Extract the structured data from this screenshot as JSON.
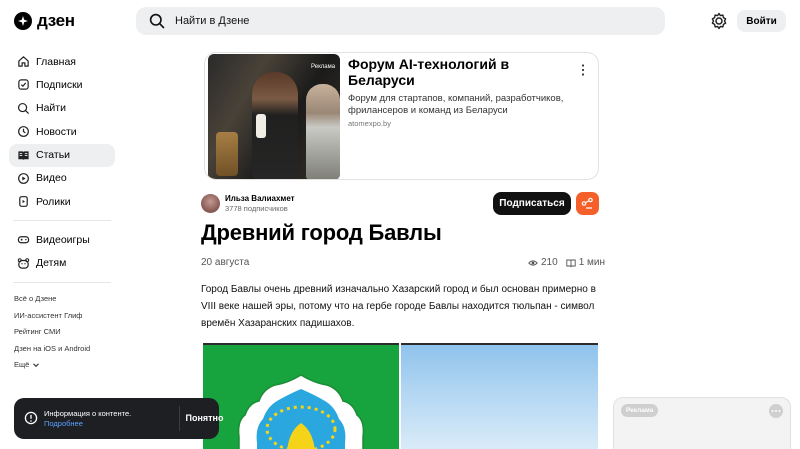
{
  "header": {
    "logo_text": "дзен",
    "search_placeholder": "Найти в Дзене",
    "login_label": "Войти"
  },
  "sidebar": {
    "items": [
      {
        "label": "Главная",
        "icon": "home-icon"
      },
      {
        "label": "Подписки",
        "icon": "subscriptions-icon"
      },
      {
        "label": "Найти",
        "icon": "search-icon"
      },
      {
        "label": "Новости",
        "icon": "news-icon"
      },
      {
        "label": "Статьи",
        "icon": "articles-icon",
        "active": true
      },
      {
        "label": "Видео",
        "icon": "video-icon"
      },
      {
        "label": "Ролики",
        "icon": "shorts-icon"
      }
    ],
    "extra_items": [
      {
        "label": "Видеоигры",
        "icon": "gamepad-icon"
      },
      {
        "label": "Детям",
        "icon": "kids-icon"
      }
    ],
    "footer_links": [
      "Всё о Дзене",
      "ИИ-ассистент Глиф",
      "Рейтинг СМИ",
      "Дзен на iOS и Android",
      "Ещё"
    ]
  },
  "ad": {
    "image_tag": "Реклама",
    "title": "Форум AI-технологий в Беларуси",
    "description": "Форум для стартапов, компаний, разработчиков, фрилансеров и команд из Беларуси",
    "domain": "atomexpo.by"
  },
  "author": {
    "name": "Ильза Валиахмет",
    "subscribers": "3778 подписчиков",
    "subscribe_label": "Подписаться"
  },
  "article": {
    "title": "Древний город Бавлы",
    "date": "20 августа",
    "views": "210",
    "read_time": "1 мин",
    "body": "Город Бавлы очень древний изначально Хазарский город и был основан примерно в VIII веке нашей эры, потому что на гербе городе Бавлы находится тюльпан - символ времён Хазаранских падишахов."
  },
  "toast": {
    "text": "Информация о контенте.",
    "link": "Подробнее",
    "button": "Понятно"
  },
  "mini_ad": {
    "tag": "Реклама"
  },
  "colors": {
    "accent_orange": "#f55f2a",
    "button_dark": "#111111",
    "active_bg": "#eeeff1",
    "emblem_green": "#17a33d"
  }
}
